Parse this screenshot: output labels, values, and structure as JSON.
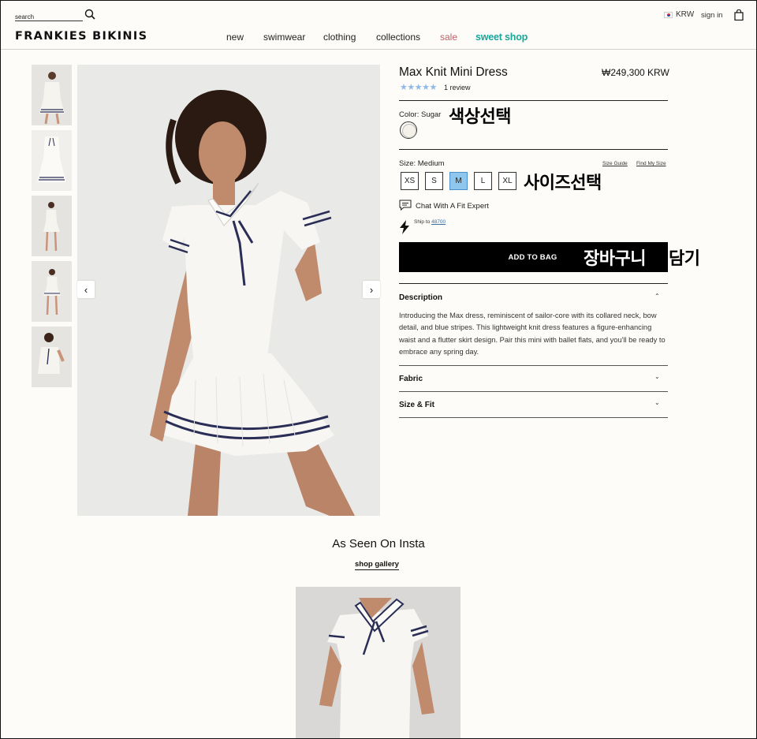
{
  "header": {
    "search_placeholder": "search",
    "logo": "FRANKIES BIKINIS",
    "nav": [
      {
        "label": "new"
      },
      {
        "label": "swimwear"
      },
      {
        "label": "clothing"
      },
      {
        "label": "collections"
      },
      {
        "label": "sale"
      },
      {
        "label": "sweet shop"
      }
    ],
    "currency": "KRW",
    "sign_in": "sign in"
  },
  "product": {
    "title": "Max Knit Mini Dress",
    "price": "₩249,300 KRW",
    "stars": "★★★★★",
    "rating": 5,
    "reviews": "1 review",
    "color_label": "Color: Sugar",
    "size_label": "Size: Medium",
    "size_guide": "Size Guide",
    "find_my_size": "Find My Size",
    "sizes": [
      "XS",
      "S",
      "M",
      "L",
      "XL"
    ],
    "selected_size": "M",
    "chat": "Chat With A Fit Expert",
    "ship_prefix": "Ship to",
    "ship_zip": "48700",
    "add_to_bag": "ADD TO BAG",
    "accordion": {
      "description": "Description",
      "description_text": "Introducing the Max dress, reminiscent of sailor-core with its collared neck, bow detail, and blue stripes. This lightweight knit dress features a figure-enhancing waist and a flutter skirt design. Pair this mini with ballet flats, and you'll be ready to embrace any spring day.",
      "fabric": "Fabric",
      "size_fit": "Size & Fit"
    }
  },
  "annotations": {
    "color": "색상선택",
    "size": "사이즈선택",
    "cart_1": "장바구니",
    "cart_2": "담기"
  },
  "insta": {
    "title": "As Seen On Insta",
    "link": "shop gallery"
  },
  "colors": {
    "sale": "#c0616a",
    "sweet_shop": "#16a79a",
    "star": "#8fb9e6",
    "selected_size": "#8ec6ee",
    "button": "#000000"
  }
}
